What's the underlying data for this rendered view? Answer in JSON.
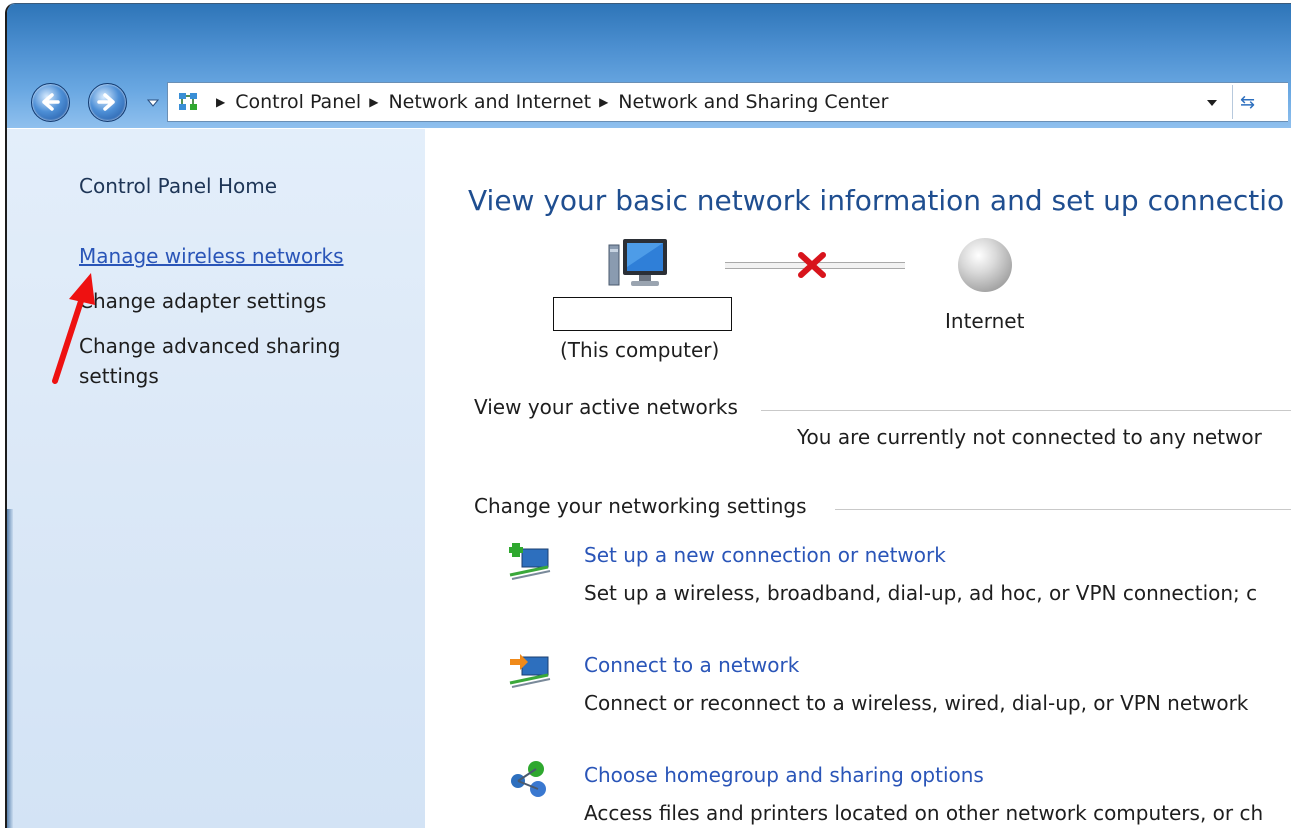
{
  "breadcrumb": {
    "items": [
      "Control Panel",
      "Network and Internet",
      "Network and Sharing Center"
    ]
  },
  "sidebar": {
    "home": "Control Panel Home",
    "links": [
      "Manage wireless networks",
      "Change adapter settings",
      "Change advanced sharing settings"
    ]
  },
  "main": {
    "title": "View your basic network information and set up connectio",
    "computer_label": "(This computer)",
    "internet_label": "Internet",
    "active_networks_heading": "View your active networks",
    "active_networks_status": "You are currently not connected to any networ",
    "settings_heading": "Change your networking settings",
    "tasks": [
      {
        "icon": "new-connection-icon",
        "link": "Set up a new connection or network",
        "desc": "Set up a wireless, broadband, dial-up, ad hoc, or VPN connection; c"
      },
      {
        "icon": "connect-network-icon",
        "link": "Connect to a network",
        "desc": "Connect or reconnect to a wireless, wired, dial-up, or VPN network"
      },
      {
        "icon": "homegroup-icon",
        "link": "Choose homegroup and sharing options",
        "desc": "Access files and printers located on other network computers, or ch"
      }
    ]
  },
  "colors": {
    "link": "#2a55b8",
    "title": "#1f4e90",
    "annotation_arrow": "#ee1111",
    "disconnected_x": "#d8141c"
  }
}
